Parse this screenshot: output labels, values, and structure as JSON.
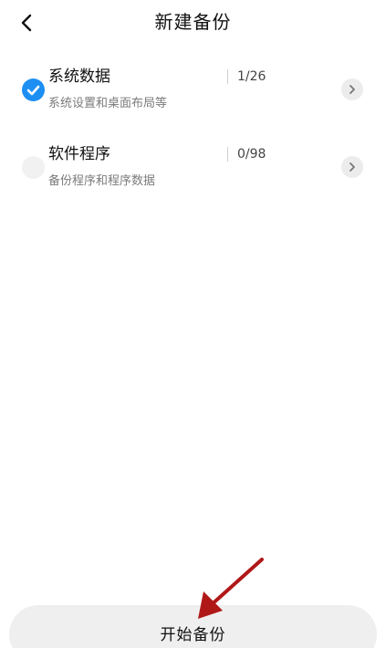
{
  "header": {
    "title": "新建备份",
    "back_icon": "chevron-left-icon"
  },
  "items": [
    {
      "title": "系统数据",
      "description": "系统设置和桌面布局等",
      "count": "1/26",
      "checked": true
    },
    {
      "title": "软件程序",
      "description": "备份程序和程序数据",
      "count": "0/98",
      "checked": false
    }
  ],
  "footer": {
    "start_label": "开始备份"
  },
  "colors": {
    "accent": "#1e8ff2",
    "annotation_arrow": "#b01818",
    "button_bg": "#efefef"
  }
}
